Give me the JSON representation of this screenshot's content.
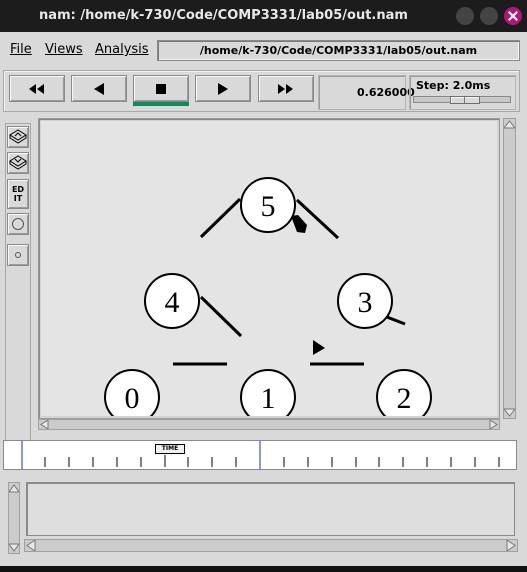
{
  "window": {
    "title": "nam: /home/k-730/Code/COMP3331/lab05/out.nam"
  },
  "menu": {
    "file": "File",
    "views": "Views",
    "analysis": "Analysis"
  },
  "path_field": "/home/k-730/Code/COMP3331/lab05/out.nam",
  "playback": {
    "time": "0.626000",
    "step_label": "Step: 2.0ms",
    "step_position": 0.42
  },
  "tools": {
    "edit_label": [
      "ED",
      "IT"
    ]
  },
  "network": {
    "nodes": [
      "0",
      "1",
      "2",
      "3",
      "4",
      "5"
    ]
  },
  "timeline": {
    "marker_label": "TIME"
  },
  "colors": {
    "active_indicator": "#0f8a5a",
    "close_button": "#b4157a",
    "canvas_bg": "#e4e4e4"
  },
  "icons": [
    "rewind-icon",
    "step-back-icon",
    "stop-icon",
    "play-icon",
    "fast-forward-icon",
    "zoom-in-icon",
    "zoom-out-icon"
  ]
}
